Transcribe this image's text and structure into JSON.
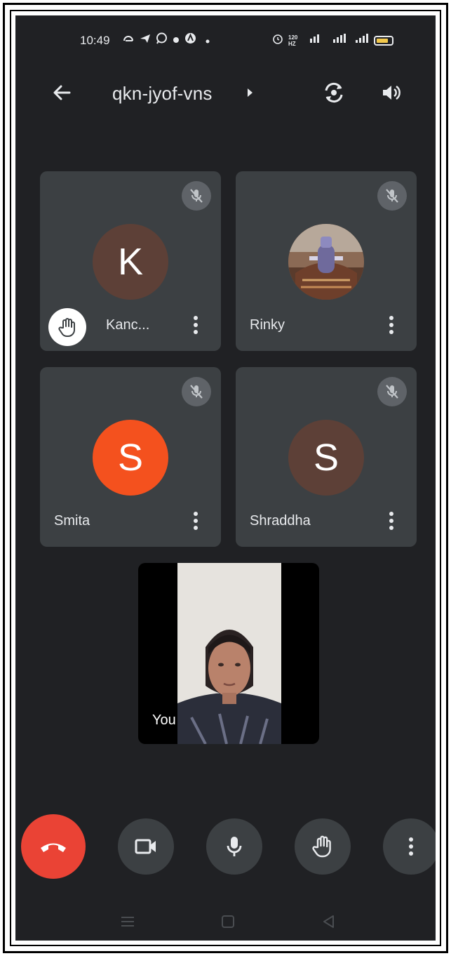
{
  "status_bar": {
    "time": "10:49",
    "left_icons": [
      "sync-icon",
      "telegram-icon",
      "whatsapp-icon",
      "dot-icon",
      "app-icon",
      "dot-icon"
    ],
    "right_icons": [
      "alarm-icon",
      "refresh-rate-icon",
      "volte-icon",
      "signal-4g-icon",
      "signal-icon",
      "battery-icon"
    ],
    "refresh_rate_text": "120 HZ"
  },
  "header": {
    "meeting_code": "qkn-jyof-vns",
    "icons": [
      "back-arrow-icon",
      "caret-right-icon",
      "switch-camera-icon",
      "speaker-icon"
    ]
  },
  "participants": [
    {
      "name": "Kanc...",
      "initial": "K",
      "avatar_color": "#5d4037",
      "muted": true,
      "hand_raised": true,
      "has_photo": false
    },
    {
      "name": "Rinky",
      "initial": "",
      "avatar_color": "#6b4a3c",
      "muted": true,
      "hand_raised": false,
      "has_photo": true
    },
    {
      "name": "Smita",
      "initial": "S",
      "avatar_color": "#f4511e",
      "muted": true,
      "hand_raised": false,
      "has_photo": false
    },
    {
      "name": "Shraddha",
      "initial": "S",
      "avatar_color": "#5d4037",
      "muted": true,
      "hand_raised": false,
      "has_photo": false
    }
  ],
  "self_view": {
    "label": "You"
  },
  "controls": {
    "buttons": [
      "end-call-icon",
      "video-camera-icon",
      "microphone-icon",
      "raise-hand-icon",
      "more-vert-icon"
    ],
    "end_call_color": "#ea4335"
  },
  "nav_bar": {
    "buttons": [
      "menu-icon",
      "home-square-icon",
      "back-triangle-icon"
    ]
  },
  "theme": {
    "background": "#202124",
    "tile": "#3c4043",
    "muted_badge": "#5f6368"
  }
}
